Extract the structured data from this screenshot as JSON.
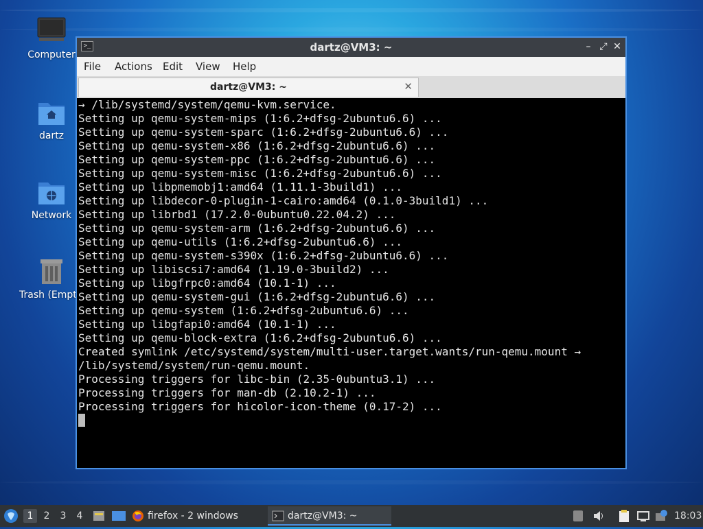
{
  "desktop": {
    "icons": [
      {
        "label": "Computer"
      },
      {
        "label": "dartz"
      },
      {
        "label": "Network"
      },
      {
        "label": "Trash (Empty)"
      }
    ]
  },
  "window": {
    "title": "dartz@VM3: ~",
    "menu": [
      "File",
      "Actions",
      "Edit",
      "View",
      "Help"
    ],
    "tab_label": "dartz@VM3: ~",
    "terminal_lines": [
      "→ /lib/systemd/system/qemu-kvm.service.",
      "Setting up qemu-system-mips (1:6.2+dfsg-2ubuntu6.6) ...",
      "Setting up qemu-system-sparc (1:6.2+dfsg-2ubuntu6.6) ...",
      "Setting up qemu-system-x86 (1:6.2+dfsg-2ubuntu6.6) ...",
      "Setting up qemu-system-ppc (1:6.2+dfsg-2ubuntu6.6) ...",
      "Setting up qemu-system-misc (1:6.2+dfsg-2ubuntu6.6) ...",
      "Setting up libpmemobj1:amd64 (1.11.1-3build1) ...",
      "Setting up libdecor-0-plugin-1-cairo:amd64 (0.1.0-3build1) ...",
      "Setting up librbd1 (17.2.0-0ubuntu0.22.04.2) ...",
      "Setting up qemu-system-arm (1:6.2+dfsg-2ubuntu6.6) ...",
      "Setting up qemu-utils (1:6.2+dfsg-2ubuntu6.6) ...",
      "Setting up qemu-system-s390x (1:6.2+dfsg-2ubuntu6.6) ...",
      "Setting up libiscsi7:amd64 (1.19.0-3build2) ...",
      "Setting up libgfrpc0:amd64 (10.1-1) ...",
      "Setting up qemu-system-gui (1:6.2+dfsg-2ubuntu6.6) ...",
      "Setting up qemu-system (1:6.2+dfsg-2ubuntu6.6) ...",
      "Setting up libgfapi0:amd64 (10.1-1) ...",
      "Setting up qemu-block-extra (1:6.2+dfsg-2ubuntu6.6) ...",
      "Created symlink /etc/systemd/system/multi-user.target.wants/run-qemu.mount →",
      "/lib/systemd/system/run-qemu.mount.",
      "Processing triggers for libc-bin (2.35-0ubuntu3.1) ...",
      "Processing triggers for man-db (2.10.2-1) ...",
      "Processing triggers for hicolor-icon-theme (0.17-2) ..."
    ]
  },
  "taskbar": {
    "workspaces": [
      "1",
      "2",
      "3",
      "4"
    ],
    "active_workspace": "1",
    "tasks": [
      {
        "label": "firefox - 2 windows",
        "icon": "firefox-icon"
      },
      {
        "label": "dartz@VM3: ~",
        "icon": "terminal-icon"
      }
    ],
    "clock": "18:03"
  },
  "colors": {
    "accent": "#4a90e2",
    "titlebar": "#3b3f45",
    "panel": "#2f3336"
  }
}
